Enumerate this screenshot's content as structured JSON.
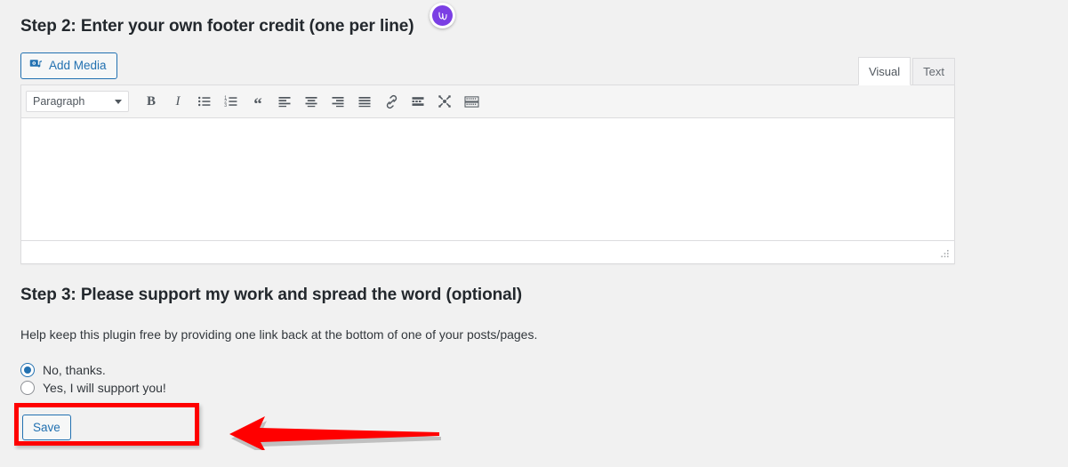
{
  "page": {
    "background_color": "#f1f1f1",
    "accent_color": "#2271b1",
    "annotation_color": "#ff0000",
    "badge_color": "#7b3fe4"
  },
  "step2": {
    "heading": "Step 2: Enter your own footer credit (one per line)",
    "badge_icon": "grammarly-w-badge-icon"
  },
  "editor": {
    "add_media_label": "Add Media",
    "add_media_icon": "media-library-icon",
    "tabs": [
      {
        "label": "Visual",
        "active": true
      },
      {
        "label": "Text",
        "active": false
      }
    ],
    "format_select": {
      "value": "Paragraph",
      "caret_icon": "chevron-down-icon"
    },
    "toolbar_buttons": [
      {
        "name": "bold-button",
        "glyph": "B",
        "title": "Bold"
      },
      {
        "name": "italic-button",
        "glyph": "I",
        "title": "Italic"
      },
      {
        "name": "bulleted-list-button",
        "glyph": "",
        "title": "Bulleted list"
      },
      {
        "name": "numbered-list-button",
        "glyph": "",
        "title": "Numbered list"
      },
      {
        "name": "blockquote-button",
        "glyph": "“",
        "title": "Blockquote"
      },
      {
        "name": "align-left-button",
        "glyph": "",
        "title": "Align left"
      },
      {
        "name": "align-center-button",
        "glyph": "",
        "title": "Align center"
      },
      {
        "name": "align-right-button",
        "glyph": "",
        "title": "Align right"
      },
      {
        "name": "justify-button",
        "glyph": "",
        "title": "Justify"
      },
      {
        "name": "insert-link-button",
        "glyph": "",
        "title": "Insert/edit link"
      },
      {
        "name": "read-more-button",
        "glyph": "",
        "title": "Insert Read More tag"
      },
      {
        "name": "distraction-free-button",
        "glyph": "",
        "title": "Distraction-free writing mode"
      },
      {
        "name": "keyboard-shortcuts-button",
        "glyph": "",
        "title": "Keyboard shortcuts"
      }
    ],
    "content": "",
    "resize_handle_icon": "resize-grip-icon"
  },
  "step3": {
    "heading": "Step 3: Please support my work and spread the word (optional)",
    "help_text": "Help keep this plugin free by providing one link back at the bottom of one of your posts/pages.",
    "options": [
      {
        "label": "No, thanks.",
        "selected": true
      },
      {
        "label": "Yes, I will support you!",
        "selected": false
      }
    ]
  },
  "actions": {
    "save_label": "Save"
  },
  "annotations": {
    "highlight_target": "save-button",
    "arrow_icon": "left-pointing-arrow-icon",
    "arrow_direction": "left"
  }
}
